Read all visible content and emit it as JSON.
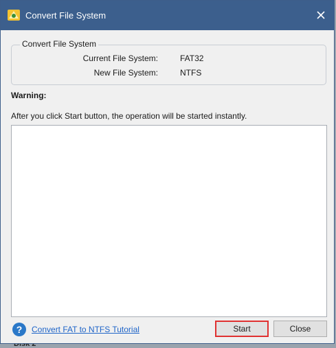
{
  "window": {
    "title": "Convert File System",
    "close_icon": "close-icon"
  },
  "group": {
    "title": "Convert File System",
    "current_label": "Current File System:",
    "current_value": "FAT32",
    "new_label": "New File System:",
    "new_value": "NTFS"
  },
  "warning": {
    "label": "Warning:",
    "text": "After you click Start button, the operation will be started instantly."
  },
  "footer": {
    "help_icon": "help-icon",
    "tutorial_link": "Convert FAT to NTFS Tutorial",
    "start_button": "Start",
    "close_button": "Close"
  },
  "backdrop": {
    "partial_text": "Disk 2"
  },
  "colors": {
    "titlebar": "#3c5f8d",
    "link": "#1e64c8",
    "highlight": "#e03030"
  }
}
